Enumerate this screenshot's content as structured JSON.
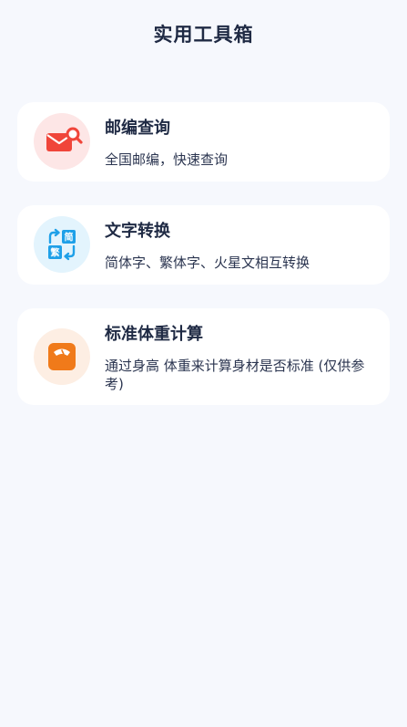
{
  "header": {
    "title": "实用工具箱"
  },
  "tools": [
    {
      "title": "邮编查询",
      "description": "全国邮编，快速查询",
      "icon": "envelope-search-icon",
      "icon_color": "#f0453a"
    },
    {
      "title": "文字转换",
      "description": "简体字、繁体字、火星文相互转换",
      "icon": "text-convert-icon",
      "icon_color": "#1ea0e8",
      "icon_glyphs": [
        "简",
        "繁"
      ]
    },
    {
      "title": "标准体重计算",
      "description": "通过身高 体重来计算身材是否标准 (仅供参考)",
      "icon": "scale-icon",
      "icon_color": "#f07a1a"
    }
  ]
}
